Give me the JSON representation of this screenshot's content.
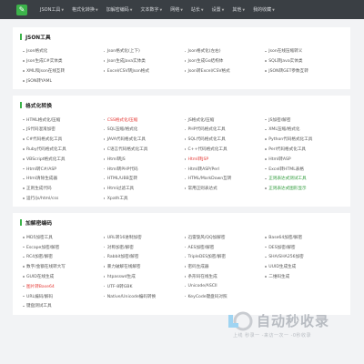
{
  "header": {
    "logo_glyph": "✎",
    "nav": [
      {
        "label": "JSON工具",
        "caret": true
      },
      {
        "label": "格式化转换",
        "caret": true
      },
      {
        "label": "加解密编码",
        "caret": true
      },
      {
        "label": "文本数字",
        "caret": true
      },
      {
        "label": "网络",
        "caret": true
      },
      {
        "label": "站长",
        "caret": true
      },
      {
        "label": "设置",
        "caret": true
      },
      {
        "label": "其他",
        "caret": true
      },
      {
        "label": "我的收藏",
        "caret": true
      }
    ]
  },
  "sections": [
    {
      "title": "JSON工具",
      "items": [
        {
          "label": "Json格式化"
        },
        {
          "label": "Json格式化(上下)"
        },
        {
          "label": "Json格式化(左右)"
        },
        {
          "label": "Json在线压缩转义"
        },
        {
          "label": "Json生成C#实体类"
        },
        {
          "label": "Json生成Java实体类"
        },
        {
          "label": "Json生成Go结构体"
        },
        {
          "label": "SQL转Java实体类"
        },
        {
          "label": "XML和Json在线互转"
        },
        {
          "label": "Excel/CSV转Json格式"
        },
        {
          "label": "Json转Excel/CSV格式"
        },
        {
          "label": "JSON转GET参数互转"
        },
        {
          "label": "JSON转YAML"
        }
      ]
    },
    {
      "title": "格式化转换",
      "items": [
        {
          "label": "HTML格式化/压缩"
        },
        {
          "label": "CSS格式化/压缩",
          "color": "red"
        },
        {
          "label": "JS格式化/压缩"
        },
        {
          "label": "JS加密/解密"
        },
        {
          "label": "JS代码混淆加密"
        },
        {
          "label": "SQL压缩/格式化"
        },
        {
          "label": "PHP代码格式化工具"
        },
        {
          "label": "XML压缩/格式化"
        },
        {
          "label": "C#代码格式化工具"
        },
        {
          "label": "JAVA代码格式化工具"
        },
        {
          "label": "SQL代码格式化工具"
        },
        {
          "label": "Python代码格式化工具"
        },
        {
          "label": "Ruby代码格式化工具"
        },
        {
          "label": "C语言代码格式化工具"
        },
        {
          "label": "C++代码格式化工具"
        },
        {
          "label": "Perl代码格式化工具"
        },
        {
          "label": "VBScript格式化工具"
        },
        {
          "label": "Html转JS"
        },
        {
          "label": "Html转JSP",
          "color": "red"
        },
        {
          "label": "Html转ASP"
        },
        {
          "label": "Html转C#/ASP"
        },
        {
          "label": "Html转PHP代码"
        },
        {
          "label": "Html转ASP/Perl"
        },
        {
          "label": "Excel转HTML表格"
        },
        {
          "label": "Html清除生成器"
        },
        {
          "label": "HTML/UBB互转"
        },
        {
          "label": "HTML/MarkDown互转"
        },
        {
          "label": "正则表达式测试工具",
          "color": "green"
        },
        {
          "label": "正则生成代码"
        },
        {
          "label": "Html过滤工具"
        },
        {
          "label": "常用正则表达式"
        },
        {
          "label": "正则表达式图形显示",
          "color": "green"
        },
        {
          "label": "运行/js/html/css"
        },
        {
          "label": "Xpath工具"
        }
      ]
    },
    {
      "title": "加解密编码",
      "items": [
        {
          "label": "MD5加密工具"
        },
        {
          "label": "URL转16进制加密"
        },
        {
          "label": "迅雷旋风/QQ加解密"
        },
        {
          "label": "Base64加密/解密"
        },
        {
          "label": "Escape加密/解密"
        },
        {
          "label": "对称加密/解密"
        },
        {
          "label": "AES加密/解密"
        },
        {
          "label": "DES加密/解密"
        },
        {
          "label": "RC4加密/解密"
        },
        {
          "label": "Rabbit加密/解密"
        },
        {
          "label": "TripleDES加密/解密"
        },
        {
          "label": "SHA/SHA256加密"
        },
        {
          "label": "数字/金额在线转大写"
        },
        {
          "label": "暴力破解在线解密"
        },
        {
          "label": "密码生成器"
        },
        {
          "label": "UUID生成生成"
        },
        {
          "label": "GUID在线生成"
        },
        {
          "label": "htpasswd生成"
        },
        {
          "label": "条形码在线生成"
        },
        {
          "label": "二维码生成"
        },
        {
          "label": "图片转Base64",
          "color": "red"
        },
        {
          "label": "UTF-8转GBK"
        },
        {
          "label": "Unicode/ASCII"
        },
        {
          "label": ""
        },
        {
          "label": "URL编码/解码"
        },
        {
          "label": "Native/Unicode编码转换"
        },
        {
          "label": "KeyCode键盘码对照"
        },
        {
          "label": ""
        },
        {
          "label": "键盘测试工具"
        }
      ]
    }
  ],
  "watermark": {
    "title": "自动秒收录",
    "subtitle": "上线 秒录一 -来访一次一 -0秒收录"
  },
  "colors": {
    "topbar": "#3a3f44",
    "accent": "#3cb34a",
    "red": "#e53935",
    "green": "#2e9b3a"
  }
}
